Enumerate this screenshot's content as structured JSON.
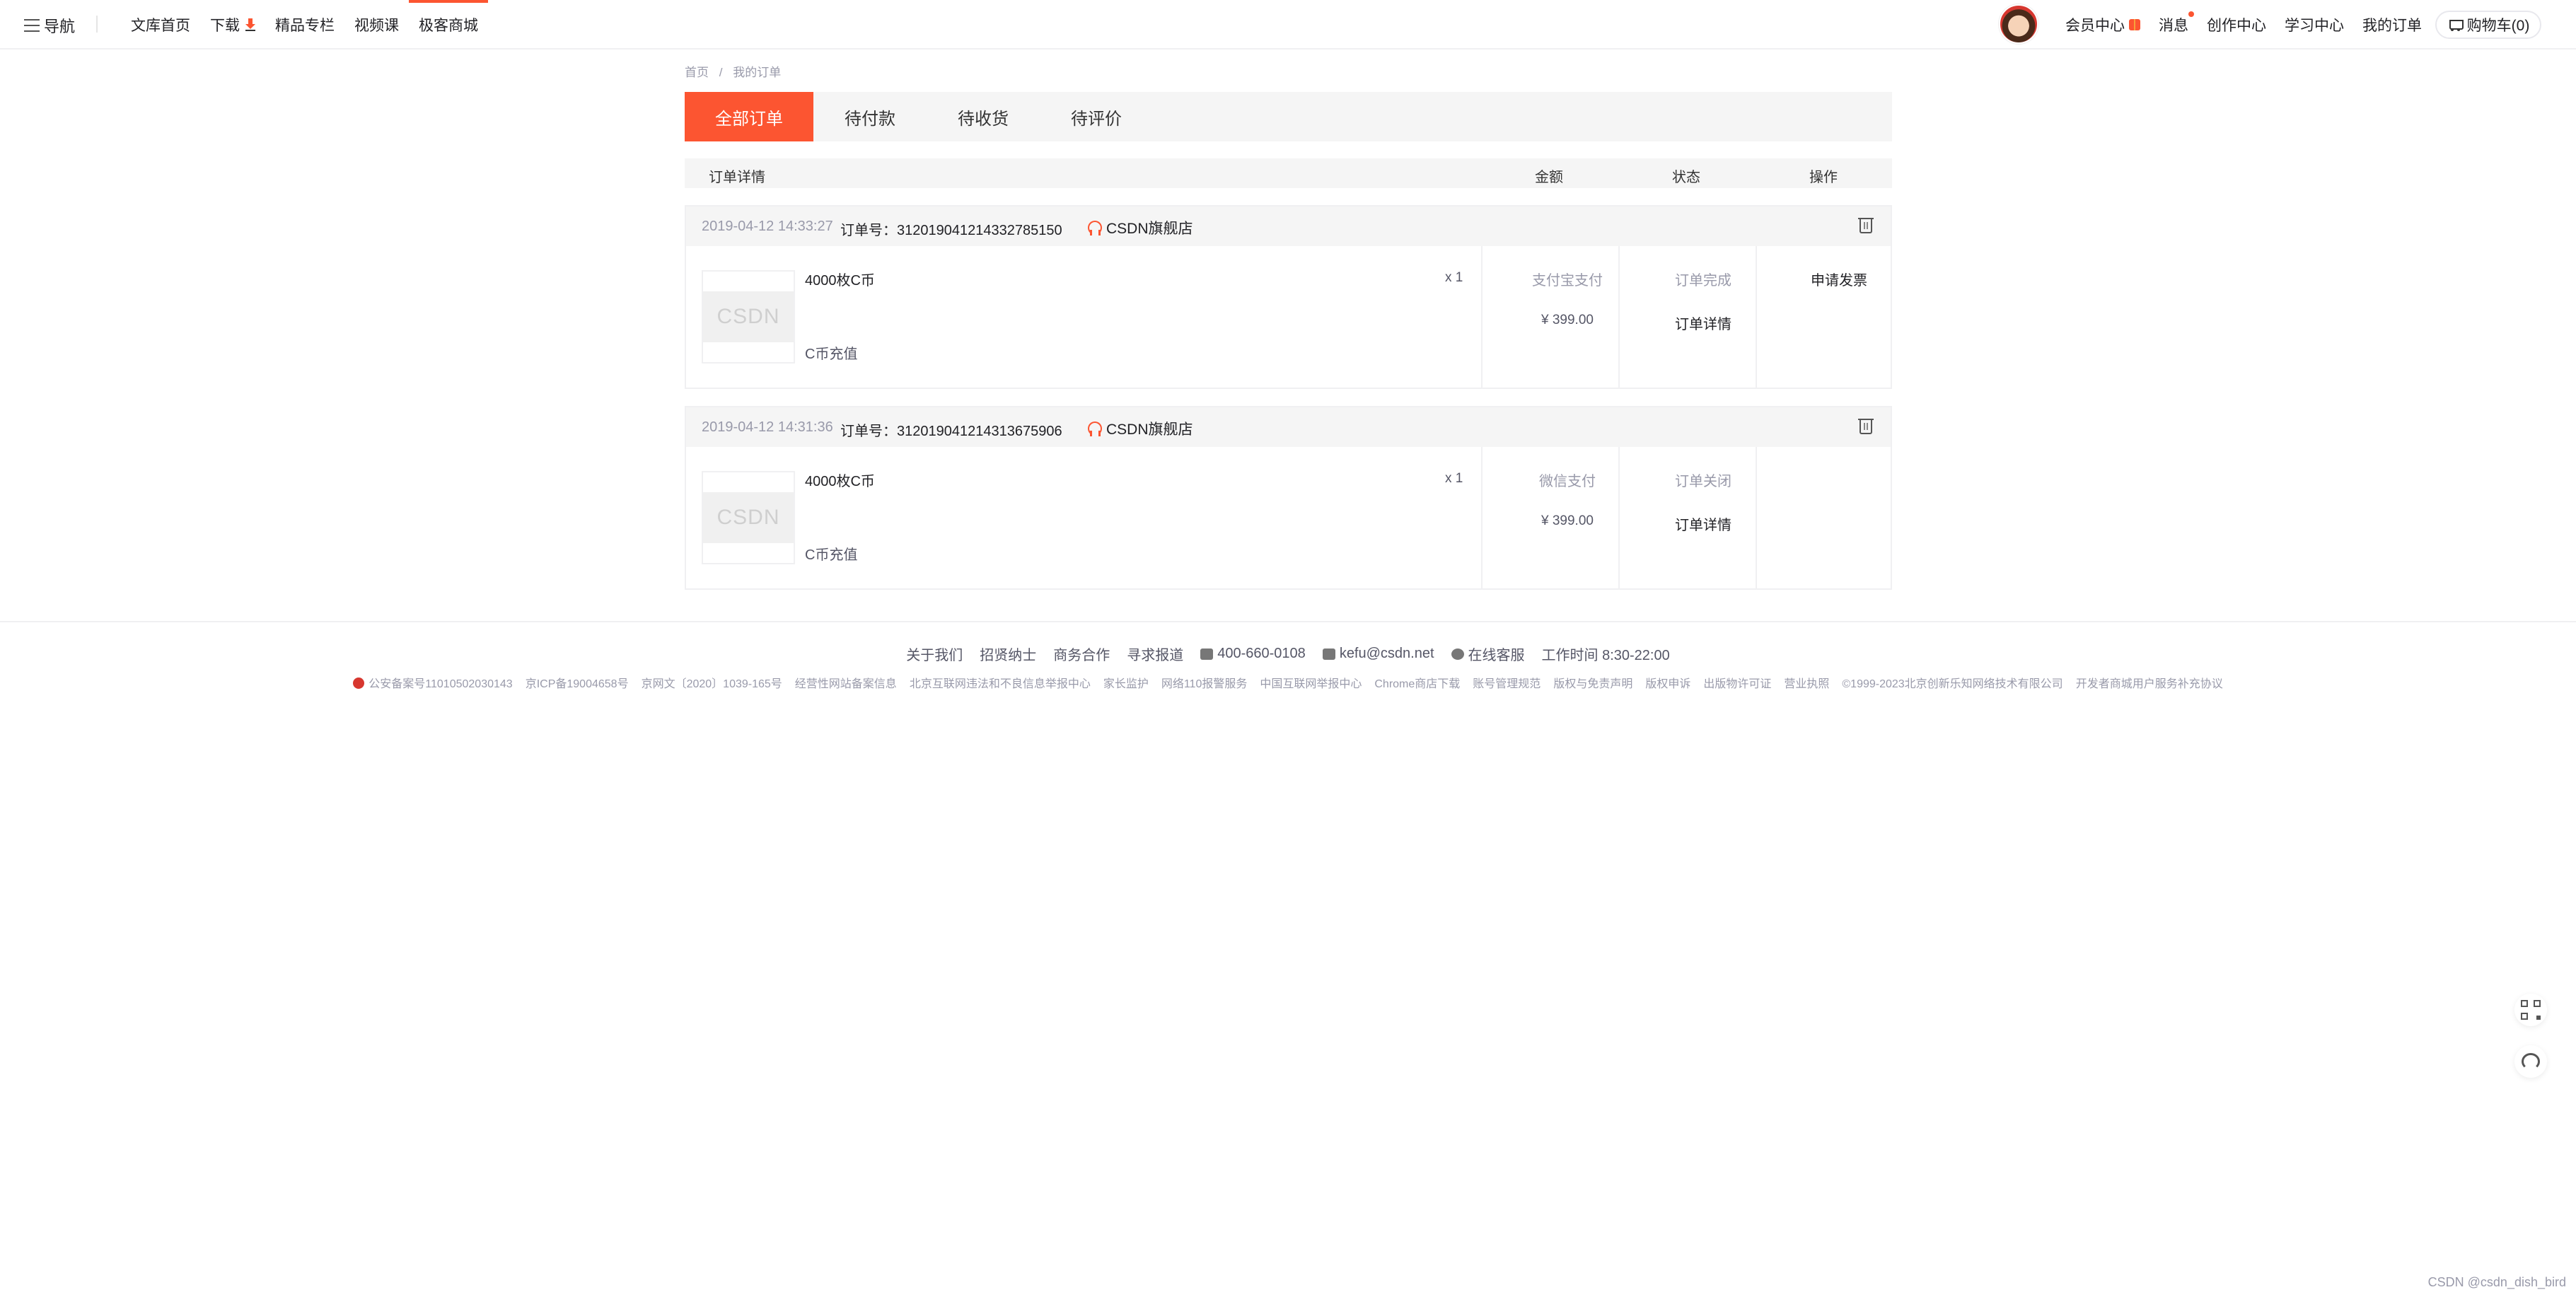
{
  "topbar": {
    "menu_label": "导航",
    "links": [
      "文库首页",
      "下载",
      "精品专栏",
      "视频课",
      "极客商城"
    ],
    "right_links": [
      "会员中心",
      "消息",
      "创作中心",
      "学习中心",
      "我的订单"
    ],
    "cart_label": "购物车(0)",
    "accent": "#fc5531"
  },
  "breadcrumb": {
    "home": "首页",
    "sep": "/",
    "current": "我的订单"
  },
  "tabs": [
    "全部订单",
    "待付款",
    "待收货",
    "待评价"
  ],
  "table_header": {
    "detail": "订单详情",
    "amount": "金额",
    "status": "状态",
    "action": "操作"
  },
  "orders": [
    {
      "time": "2019-04-12 14:33:27",
      "order_no": "订单号：312019041214332785150",
      "shop": "CSDN旗舰店",
      "product": "4000枚C币",
      "category": "C币充值",
      "qty": "x 1",
      "pay_method": "支付宝支付",
      "amount": "¥ 399.00",
      "status": "订单完成",
      "detail_link": "订单详情",
      "action": "申请发票",
      "thumb_logo": "CSDN"
    },
    {
      "time": "2019-04-12 14:31:36",
      "order_no": "订单号：312019041214313675906",
      "shop": "CSDN旗舰店",
      "product": "4000枚C币",
      "category": "C币充值",
      "qty": "x 1",
      "pay_method": "微信支付",
      "amount": "¥ 399.00",
      "status": "订单关闭",
      "detail_link": "订单详情",
      "action": "",
      "thumb_logo": "CSDN"
    }
  ],
  "footer": {
    "row1": [
      "关于我们",
      "招贤纳士",
      "商务合作",
      "寻求报道",
      "400-660-0108",
      "kefu@csdn.net",
      "在线客服",
      "工作时间 8:30-22:00"
    ],
    "row2": [
      "公安备案号11010502030143",
      "京ICP备19004658号",
      "京网文〔2020〕1039-165号",
      "经营性网站备案信息",
      "北京互联网违法和不良信息举报中心",
      "家长监护",
      "网络110报警服务",
      "中国互联网举报中心",
      "Chrome商店下载",
      "账号管理规范",
      "版权与免责声明",
      "版权申诉",
      "出版物许可证",
      "营业执照",
      "©1999-2023北京创新乐知网络技术有限公司",
      "开发者商城用户服务补充协议"
    ]
  },
  "watermark": "CSDN @csdn_dish_bird"
}
